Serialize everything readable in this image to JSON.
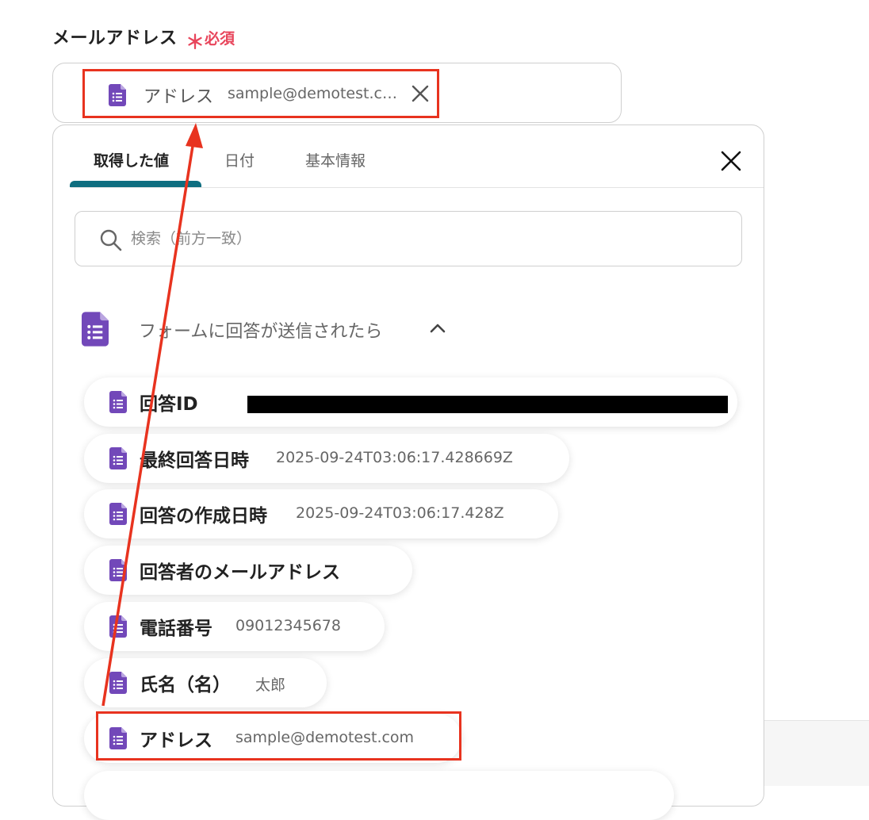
{
  "field": {
    "label": "メールアドレス",
    "required_mark": "＊",
    "required_text": "必須"
  },
  "chip": {
    "label": "アドレス",
    "value": "sample@demotest.com"
  },
  "tabs": [
    {
      "label": "取得した値",
      "active": true
    },
    {
      "label": "日付",
      "active": false
    },
    {
      "label": "基本情報",
      "active": false
    }
  ],
  "search": {
    "placeholder": "検索（前方一致）"
  },
  "group": {
    "title": "フォームに回答が送信されたら"
  },
  "rows": [
    {
      "label": "回答ID",
      "value": ""
    },
    {
      "label": "最終回答日時",
      "value": "2025-09-24T03:06:17.428669Z"
    },
    {
      "label": "回答の作成日時",
      "value": "2025-09-24T03:06:17.428Z"
    },
    {
      "label": "回答者のメールアドレス",
      "value": ""
    },
    {
      "label": "電話番号",
      "value": "09012345678"
    },
    {
      "label": "氏名（名）",
      "value": "太郎"
    },
    {
      "label": "アドレス",
      "value": "sample@demotest.com"
    }
  ],
  "colors": {
    "accent": "#0e6e80",
    "required": "#e8455b",
    "highlight": "#e8331f",
    "form_icon": "#7248b9"
  }
}
